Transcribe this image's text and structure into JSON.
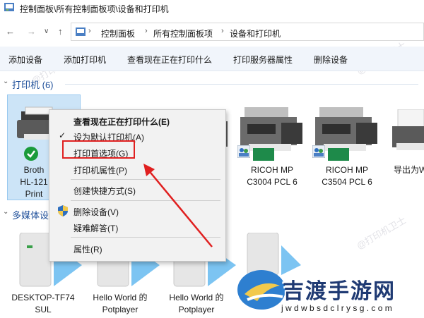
{
  "window": {
    "title": "控制面板\\所有控制面板项\\设备和打印机"
  },
  "nav": {
    "back": "←",
    "forward": "→",
    "dropdown": "∨",
    "up": "↑"
  },
  "address": {
    "crumbs": [
      "控制面板",
      "所有控制面板项",
      "设备和打印机"
    ],
    "separator": "›"
  },
  "toolbar": {
    "items": [
      "添加设备",
      "添加打印机",
      "查看现在正在打印什么",
      "打印服务器属性",
      "删除设备"
    ]
  },
  "printers": {
    "header": "打印机 (6)",
    "devices": [
      {
        "line1": "Broth",
        "line2": "HL-121",
        "line3": "Print"
      },
      {
        "line1": "RICOH MP",
        "line2": "C3004 PCL 6"
      },
      {
        "line1": "RICOH MP",
        "line2": "C3504 PCL 6"
      },
      {
        "line1": "导出为W",
        "line2": ""
      }
    ]
  },
  "media": {
    "header": "多媒体设",
    "devices": [
      {
        "line1": "DESKTOP-TF74",
        "line2": "SUL"
      },
      {
        "line1": "Hello World 的",
        "line2": "Potplayer"
      },
      {
        "line1": "Hello World 的",
        "line2": "Potplayer"
      }
    ]
  },
  "context_menu": {
    "items": [
      {
        "label": "查看现在正在打印什么(E)",
        "bold": true
      },
      {
        "label": "设为默认打印机(A)",
        "checked": true
      },
      {
        "label": "打印首选项(G)",
        "highlighted": true
      },
      {
        "label": "打印机属性(P)"
      },
      {
        "label": "创建快捷方式(S)"
      },
      {
        "label": "删除设备(V)",
        "shield": true
      },
      {
        "label": "疑难解答(T)"
      },
      {
        "label": "属性(R)"
      }
    ]
  },
  "watermark": {
    "text": "@打印机卫士",
    "brand": "吉渡手游网",
    "url": "j w d w b s d c l r y s g . c o m"
  },
  "colors": {
    "accent": "#1e4f9a",
    "highlight": "#e02020",
    "selection": "#cce4f7",
    "check_green": "#1a9b3b"
  }
}
